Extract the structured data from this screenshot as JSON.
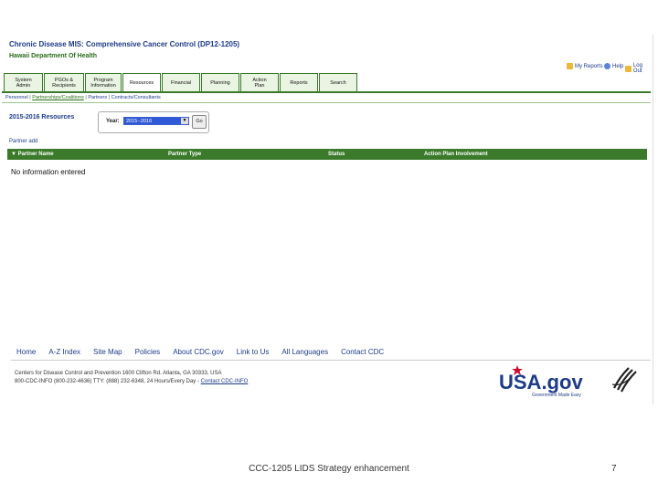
{
  "header": {
    "title": "Chronic Disease MIS: Comprehensive Cancer Control (DP12-1205)",
    "subtitle": "Hawaii Department Of Health"
  },
  "utility_links": [
    {
      "label": "My Reports",
      "icon": "reports-icon"
    },
    {
      "label": "Help",
      "icon": "help-icon"
    },
    {
      "label": "Log Out",
      "icon": "logout-icon"
    }
  ],
  "tabs": [
    {
      "line1": "System",
      "line2": "Admin"
    },
    {
      "line1": "PGOs &",
      "line2": "Recipients"
    },
    {
      "line1": "Program",
      "line2": "Information"
    },
    {
      "line1": "Resources",
      "line2": ""
    },
    {
      "line1": "Financial",
      "line2": ""
    },
    {
      "line1": "Planning",
      "line2": ""
    },
    {
      "line1": "Action",
      "line2": "Plan"
    },
    {
      "line1": "Reports",
      "line2": ""
    },
    {
      "line1": "Search",
      "line2": ""
    }
  ],
  "subnav": {
    "personnel": "Personnel",
    "partnerships": "Partnerships/Coalitions",
    "partners": "Partners",
    "contracts": "Contracts/Consultants"
  },
  "section_title": "2015-2016 Resources",
  "year_selector": {
    "label": "Year:",
    "value": "2015--2016",
    "go_label": "Go"
  },
  "partner_add": "Partner add",
  "table": {
    "columns": [
      "▼ Partner Name",
      "Partner Type",
      "Status",
      "Action Plan Involvement"
    ],
    "empty_message": "No information entered"
  },
  "footer": {
    "nav": [
      "Home",
      "A-Z Index",
      "Site Map",
      "Policies",
      "About CDC.gov",
      "Link to Us",
      "All Languages",
      "Contact CDC"
    ],
    "address_line1": "Centers for Disease Control and Prevention   1600 Clifton Rd. Atlanta, GA 30333, USA",
    "address_line2": "800-CDC-INFO (800-232-4636) TTY: (888) 232-6348, 24 Hours/Every Day - ",
    "contact_link": "Contact CDC-INFO",
    "usagov_logo": "USA.gov",
    "usagov_tagline": "Government Made Easy"
  },
  "slide": {
    "caption": "CCC-1205 LIDS Strategy enhancement",
    "page_number": "7"
  },
  "colors": {
    "brand_green": "#3a7a2a",
    "brand_blue": "#1d3b87",
    "usagov_red": "#c8102e"
  }
}
